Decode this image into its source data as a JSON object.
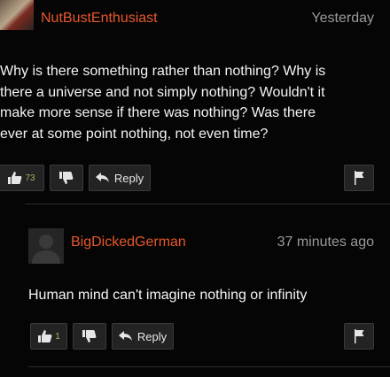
{
  "comments": [
    {
      "username": "NutBustEnthusiast",
      "timestamp": "Yesterday",
      "text_lines": [
        "Why is there something rather than nothing? Why is",
        "there a universe and not simply nothing? Wouldn't it",
        "make more sense if there was nothing? Was there",
        "ever at some point nothing, not even time?"
      ],
      "upvotes": "73",
      "reply_label": "Reply"
    },
    {
      "username": "BigDickedGerman",
      "timestamp": "37 minutes ago",
      "text_lines": [
        "Human mind can't imagine nothing or infinity"
      ],
      "upvotes": "1",
      "reply_label": "Reply"
    }
  ],
  "icons": {
    "thumbs_up": "thumbs-up-icon",
    "thumbs_down": "thumbs-down-icon",
    "reply": "reply-arrow-icon",
    "flag": "flag-icon"
  },
  "colors": {
    "username": "#e8582c",
    "timestamp": "#9a9a9a",
    "vote_count": "#9fb35a",
    "background": "#050505"
  }
}
